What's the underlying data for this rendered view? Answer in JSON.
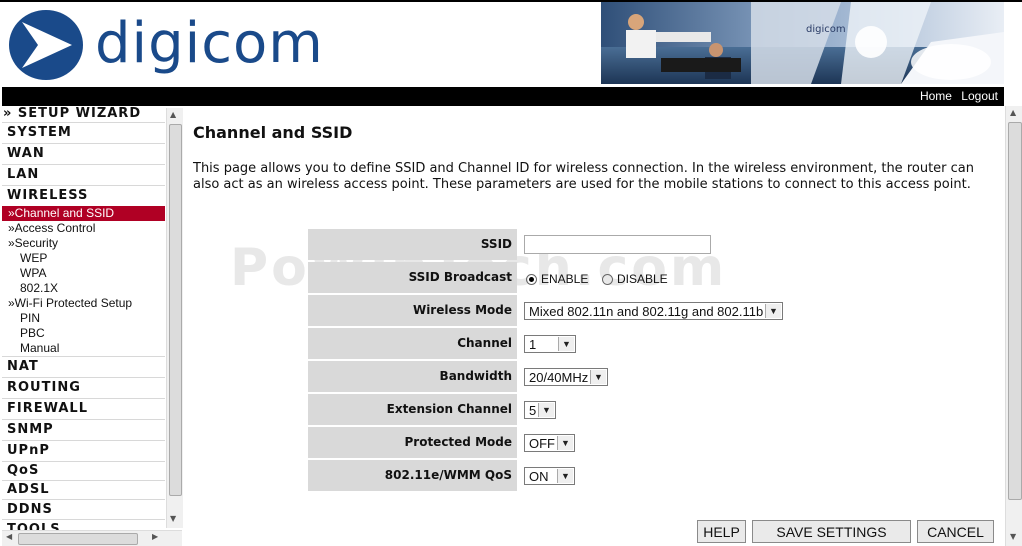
{
  "brand": {
    "logo_text": "digicom",
    "logo_color": "#1a4a8a",
    "banner_logo_text": "digicom"
  },
  "nav": {
    "home_label": "Home",
    "logout_label": "Logout"
  },
  "sidebar": {
    "setup_wizard": "» SETUP WIZARD",
    "system": "SYSTEM",
    "wan": "WAN",
    "lan": "LAN",
    "wireless": "WIRELESS",
    "sub": {
      "channel_ssid": "»Channel and SSID",
      "access_control": "»Access Control",
      "security": "»Security",
      "wep": "WEP",
      "wpa": "WPA",
      "x8021": "802.1X",
      "wps": "»Wi-Fi Protected Setup",
      "pin": "PIN",
      "pbc": "PBC",
      "manual": "Manual"
    },
    "nat": "NAT",
    "routing": "ROUTING",
    "firewall": "FIREWALL",
    "snmp": "SNMP",
    "upnp": "UPnP",
    "qos": "QoS",
    "adsl": "ADSL",
    "ddns": "DDNS",
    "tools": "TOOLS",
    "active_color": "#b00024"
  },
  "main": {
    "title": "Channel and SSID",
    "description": "This page allows you to define SSID and Channel ID for wireless connection.  In the wireless environment, the router can also act as an wireless access point.  These parameters are used for the mobile stations to connect to this access point."
  },
  "watermark": "PoWinTech.com",
  "form": {
    "ssid_label": "SSID",
    "ssid_value": "",
    "ssid_broadcast_label": "SSID Broadcast",
    "enable_label": "ENABLE",
    "disable_label": "DISABLE",
    "ssid_broadcast_selected": "ENABLE",
    "wireless_mode_label": "Wireless Mode",
    "wireless_mode_value": "Mixed 802.11n and 802.11g and 802.11b",
    "channel_label": "Channel",
    "channel_value": "1",
    "bandwidth_label": "Bandwidth",
    "bandwidth_value": "20/40MHz",
    "ext_channel_label": "Extension Channel",
    "ext_channel_value": "5",
    "protected_mode_label": "Protected Mode",
    "protected_mode_value": "OFF",
    "wmm_label": "802.11e/WMM QoS",
    "wmm_value": "ON"
  },
  "buttons": {
    "help": "HELP",
    "save": "SAVE SETTINGS",
    "cancel": "CANCEL"
  }
}
